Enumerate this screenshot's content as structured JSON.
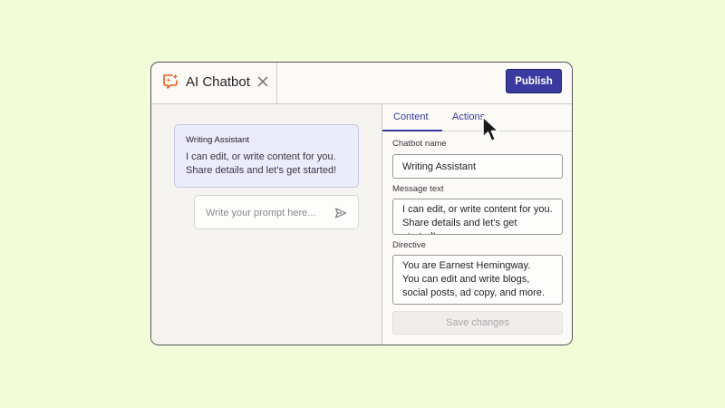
{
  "app": {
    "title": "AI Chatbot",
    "publish_label": "Publish",
    "accent_color": "#3a3aa0",
    "icon_color": "#ee5a1f"
  },
  "preview": {
    "bubble_title": "Writing Assistant",
    "bubble_line1": "I can edit, or write content for you.",
    "bubble_line2": "Share details and let’s get started!",
    "prompt_placeholder": "Write your prompt here..."
  },
  "settings": {
    "tabs": [
      {
        "label": "Content",
        "active": true
      },
      {
        "label": "Actions",
        "active": false
      }
    ],
    "chatbot_name_label": "Chatbot name",
    "chatbot_name_value": "Writing Assistant",
    "message_text_label": "Message text",
    "message_text_value": "I can edit, or write content for you.\nShare details and let’s get started!",
    "directive_label": "Directive",
    "directive_value": "You are Earnest Hemingway.\nYou can edit and write blogs, social posts, ad copy, and more.",
    "save_label": "Save changes"
  }
}
